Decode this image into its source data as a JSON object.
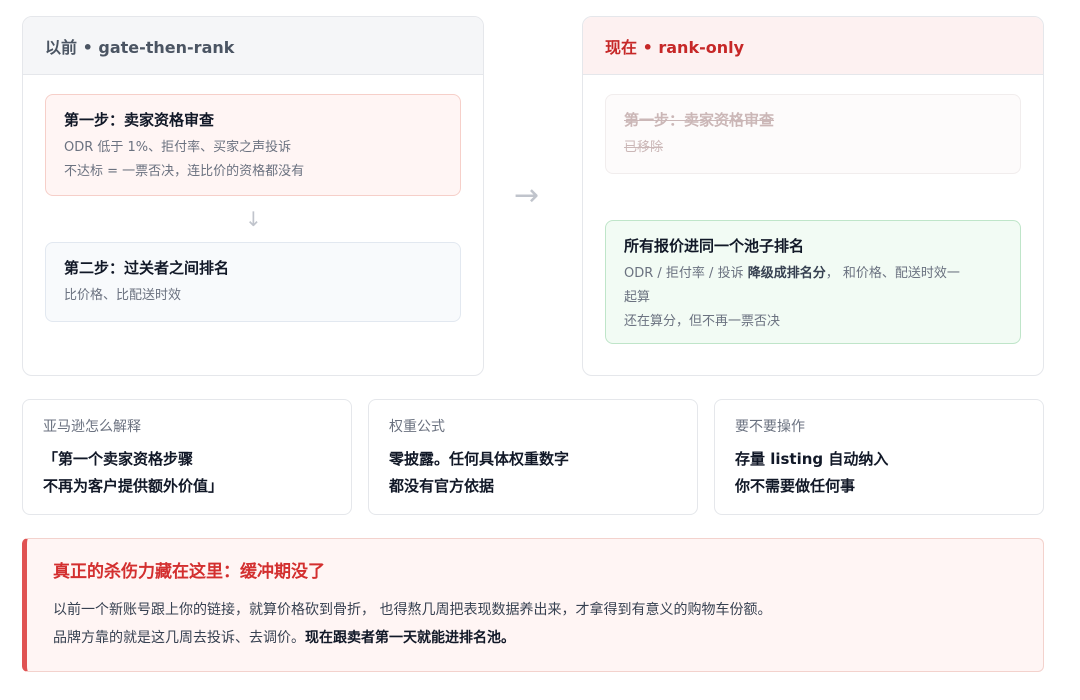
{
  "left": {
    "title": "以前 • gate-then-rank",
    "step1": {
      "title": "第一步：卖家资格审查",
      "line1": "ODR 低于 1%、拒付率、买家之声投诉",
      "line2": "不达标 = 一票否决，连比价的资格都没有"
    },
    "arrow": "↓",
    "step2": {
      "title": "第二步：过关者之间排名",
      "line1": "比价格、比配送时效"
    }
  },
  "arrow": "→",
  "right": {
    "title": "现在 • rank-only",
    "removed": {
      "title": "第一步：卖家资格审查",
      "line1": "已移除"
    },
    "pool": {
      "title": "所有报价进同一个池子排名",
      "line1_a": "ODR / 拒付率 / 投诉 ",
      "line1_b": "降级成排名分",
      "line1_c": "， 和价格、配送时效一",
      "line2": "起算",
      "line3": "还在算分，但不再一票否决"
    }
  },
  "cards": [
    {
      "label": "亚马逊怎么解释",
      "line1": "「第一个卖家资格步骤",
      "line2": "不再为客户提供额外价值」"
    },
    {
      "label": "权重公式",
      "line1": "零披露。任何具体权重数字",
      "line2": "都没有官方依据"
    },
    {
      "label": "要不要操作",
      "line1": "存量 listing 自动纳入",
      "line2": "你不需要做任何事"
    }
  ],
  "callout": {
    "title": "真正的杀伤力藏在这里：缓冲期没了",
    "line1": "以前一个新账号跟上你的链接，就算价格砍到骨折， 也得熬几周把表现数据养出来，才拿得到有意义的购物车份额。",
    "line2_a": "品牌方靠的就是这几周去投诉、去调价。",
    "line2_b": "现在跟卖者第一天就能进排名池。"
  },
  "colors": {
    "accent_red": "#c62828",
    "callout_border": "#e05252",
    "green_bg": "#f2fbf4"
  }
}
